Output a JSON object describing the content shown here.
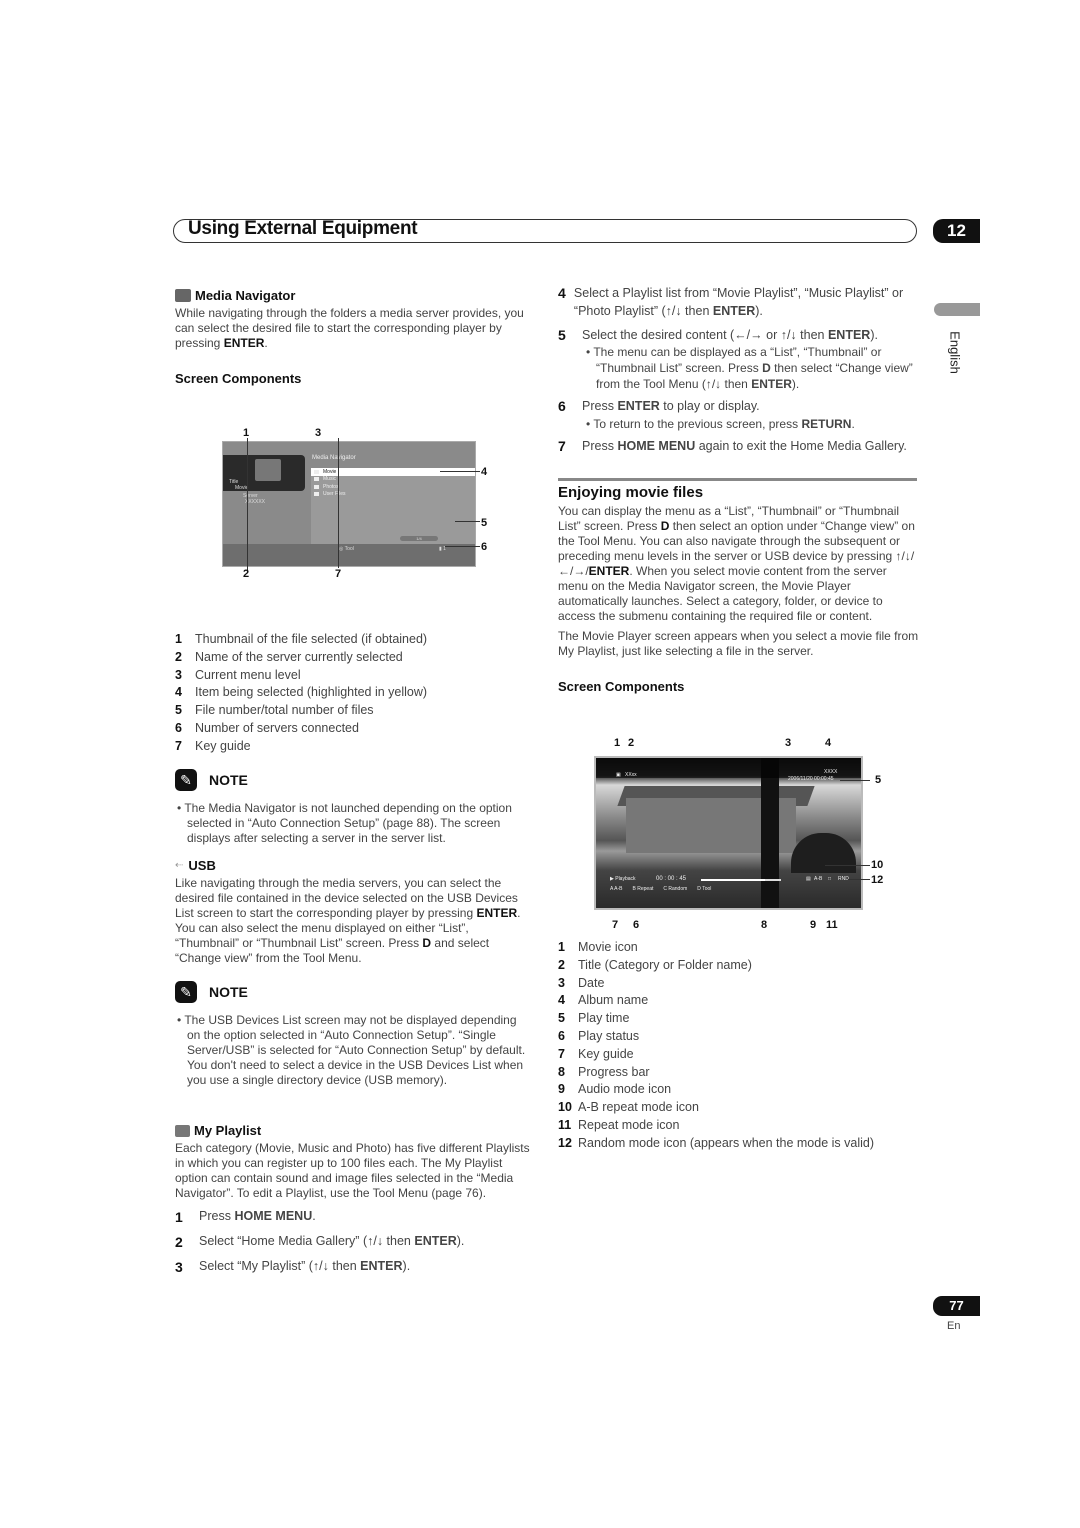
{
  "header": {
    "title": "Using External Equipment",
    "chapter": "12"
  },
  "side_tab": {
    "language": "English"
  },
  "footer": {
    "page_number": "77",
    "lang_code": "En"
  },
  "left": {
    "media_navigator": {
      "icon": "media-navigator-icon",
      "title": "Media Navigator",
      "body_pre": "While navigating through the folders a media server provides, you can select the desired file to start the corresponding player by pressing ",
      "body_bold": "ENTER",
      "body_post": ".",
      "screen_components_title": "Screen Components",
      "figure": {
        "title": "Media Navigator",
        "thumb_title_label": "Title",
        "thumb_title_value": "Movie",
        "server_label": "Server",
        "server_value": "XXXXXX",
        "menu_items": [
          "Movie",
          "Music",
          "Photos",
          "User Files"
        ],
        "selected_item": "Movie",
        "counter": "1/4",
        "key_guide": "Tool",
        "servers_count": "1",
        "callouts": [
          "1",
          "2",
          "3",
          "4",
          "5",
          "6",
          "7"
        ]
      },
      "components": [
        {
          "n": "1",
          "text": "Thumbnail of the file selected (if obtained)"
        },
        {
          "n": "2",
          "text": "Name of the server currently selected"
        },
        {
          "n": "3",
          "text": "Current menu level"
        },
        {
          "n": "4",
          "text": "Item being selected (highlighted in yellow)"
        },
        {
          "n": "5",
          "text": "File number/total number of files"
        },
        {
          "n": "6",
          "text": "Number of servers connected"
        },
        {
          "n": "7",
          "text": "Key guide"
        }
      ],
      "note": {
        "title": "NOTE",
        "bullet": "The Media Navigator is not launched depending on the option selected in “Auto Connection Setup” (page 88). The screen displays after selecting a server in the server list."
      }
    },
    "usb": {
      "icon": "usb-icon",
      "title": "USB",
      "body_1": "Like navigating through the media servers, you can select the desired file contained in the device selected on the USB Devices List screen to start the corresponding player by pressing ",
      "body_bold_1": "ENTER",
      "body_2": ". You can also select the menu displayed on either “List”, “Thumbnail” or “Thumbnail List” screen. Press ",
      "body_bold_2": "D",
      "body_3": " and select “Change view” from the Tool Menu.",
      "note": {
        "title": "NOTE",
        "bullet": "The USB Devices List screen may not be displayed depending on the option selected in “Auto Connection Setup”. “Single Server/USB” is selected for “Auto Connection Setup” by default. You don't need to select a device in the USB Devices List when you use a single directory device (USB memory)."
      }
    },
    "my_playlist": {
      "icon": "my-playlist-icon",
      "title": "My Playlist",
      "body": "Each category (Movie, Music and Photo) has five different Playlists in which you can register up to 100 files each. The My Playlist option can contain sound and image files selected in the “Media Navigator”. To edit a Playlist, use the Tool Menu (page 76).",
      "steps": [
        {
          "n": "1",
          "pre": "Press ",
          "bold": "HOME MENU",
          "post": "."
        },
        {
          "n": "2",
          "pre": "Select “Home Media Gallery” (↑/↓ then ",
          "bold": "ENTER",
          "post": ")."
        },
        {
          "n": "3",
          "pre": "Select “My Playlist” (↑/↓ then ",
          "bold": "ENTER",
          "post": ")."
        }
      ]
    }
  },
  "right": {
    "steps": [
      {
        "n": "4",
        "pre": "Select a Playlist list from “Movie Playlist”, “Music Playlist” or “Photo Playlist” (↑/↓ then ",
        "bold": "ENTER",
        "post": ")."
      },
      {
        "n": "5",
        "pre": "Select the desired content (←/→ or ↑/↓ then ",
        "bold": "ENTER",
        "post": ")."
      },
      {
        "n": "6",
        "pre": "Press ",
        "bold": "ENTER",
        "post": " to play or display."
      },
      {
        "n": "7",
        "pre": "Press ",
        "bold": "HOME MENU",
        "post": " again to exit the Home Media Gallery."
      }
    ],
    "step5_bullet": {
      "pre": "The menu can be displayed as a “List”, “Thumbnail” or “Thumbnail List” screen. Press ",
      "bold": "D",
      "mid": " then select “Change view” from the Tool Menu (↑/↓ then ",
      "bold2": "ENTER",
      "post": ")."
    },
    "step6_bullet": {
      "pre": "To return to the previous screen, press ",
      "bold": "RETURN",
      "post": "."
    },
    "enjoying": {
      "title": "Enjoying movie files",
      "p1_a": "You can display the menu as a “List”, “Thumbnail” or “Thumbnail List” screen. Press ",
      "p1_b": "D",
      "p1_c": " then select an option under “Change view” on the Tool Menu. You can also navigate through the subsequent or preceding menu levels in the server or USB device by pressing ↑/↓/←/→/",
      "p1_d": "ENTER",
      "p1_e": ". When you select movie content from the server menu on the Media Navigator screen, the Movie Player automatically launches. Select a category, folder, or device to access the submenu containing the required file or content.",
      "p2": "The Movie Player screen appears when you select a movie file from My Playlist, just like selecting a file in the server.",
      "screen_components_title": "Screen Components",
      "figure": {
        "title_value": "XXxx",
        "album_value": "XXXX",
        "date_time": "2006/11/20  00:00:45",
        "play_status": "▶ Playback",
        "play_time": "00 : 00 : 45",
        "progress": 0.8,
        "keys": [
          "A  A-B",
          "B  Repeat",
          "C  Random",
          "D  Tool"
        ],
        "ab_label": "A-B",
        "rnd_label": "RND",
        "callouts_top": [
          "1",
          "2",
          "3",
          "4"
        ],
        "callouts_right": [
          "5",
          "10",
          "12"
        ],
        "callouts_bottom": [
          "7",
          "6",
          "8",
          "9",
          "11"
        ]
      },
      "components": [
        {
          "n": "1",
          "text": "Movie icon"
        },
        {
          "n": "2",
          "text": "Title (Category or Folder name)"
        },
        {
          "n": "3",
          "text": "Date"
        },
        {
          "n": "4",
          "text": "Album name"
        },
        {
          "n": "5",
          "text": "Play time"
        },
        {
          "n": "6",
          "text": "Play status"
        },
        {
          "n": "7",
          "text": "Key guide"
        },
        {
          "n": "8",
          "text": "Progress bar"
        },
        {
          "n": "9",
          "text": "Audio mode icon"
        },
        {
          "n": "10",
          "text": "A-B repeat mode icon"
        },
        {
          "n": "11",
          "text": "Repeat mode icon"
        },
        {
          "n": "12",
          "text": "Random mode icon (appears when the mode is valid)"
        }
      ]
    }
  }
}
